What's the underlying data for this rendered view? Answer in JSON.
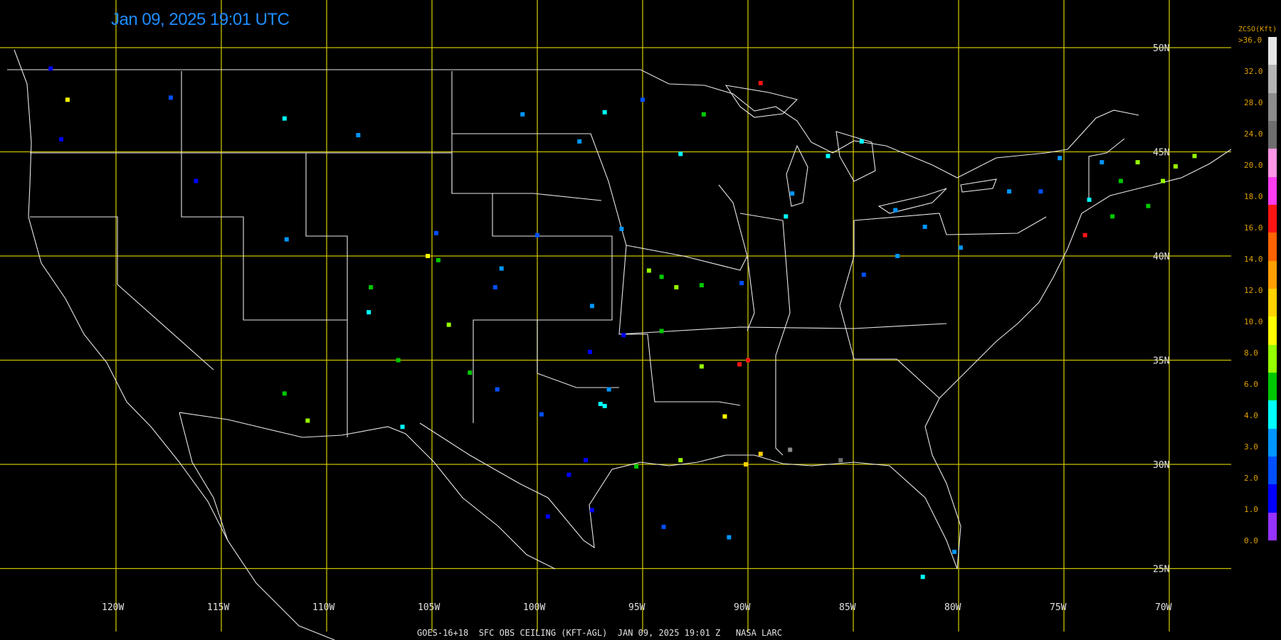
{
  "title": "Jan 09, 2025 19:01 UTC",
  "footer": "GOES-16+18  SFC OBS CEILING (KFT-AGL)  JAN 09, 2025 19:01 Z   NASA LARC",
  "grid": {
    "lon_labels": [
      "120W",
      "115W",
      "110W",
      "105W",
      "100W",
      "95W",
      "90W",
      "85W",
      "80W",
      "75W",
      "70W"
    ],
    "lat_labels": [
      "50N",
      "45N",
      "40N",
      "35N",
      "30N",
      "25N"
    ]
  },
  "legend": {
    "title": "ZCSO(Kft)",
    "labels": [
      ">36.0",
      "32.0",
      "28.0",
      "24.0",
      "20.0",
      "18.0",
      "16.0",
      "14.0",
      "12.0",
      "10.0",
      "8.0",
      "6.0",
      "4.0",
      "3.0",
      "2.0",
      "1.0",
      "0.0"
    ],
    "colors": [
      "#e6e6e6",
      "#b4b4b4",
      "#8c8c8c",
      "#6e6e6e",
      "#ff96e6",
      "#ff3cf0",
      "#ff1414",
      "#ff6400",
      "#ffa000",
      "#ffd200",
      "#ffff00",
      "#96ff00",
      "#00c800",
      "#00ffff",
      "#0096ff",
      "#0050ff",
      "#0000ff",
      "#9632ff"
    ]
  },
  "stations": [
    {
      "lon": -123.1,
      "lat": 49.0,
      "c": 16
    },
    {
      "lon": -122.3,
      "lat": 47.5,
      "c": 10
    },
    {
      "lon": -122.6,
      "lat": 45.6,
      "c": 16
    },
    {
      "lon": -117.4,
      "lat": 47.6,
      "c": 15
    },
    {
      "lon": -116.2,
      "lat": 43.6,
      "c": 16
    },
    {
      "lon": -112.0,
      "lat": 46.6,
      "c": 13
    },
    {
      "lon": -108.5,
      "lat": 45.8,
      "c": 14
    },
    {
      "lon": -111.9,
      "lat": 40.8,
      "c": 14
    },
    {
      "lon": -104.8,
      "lat": 41.1,
      "c": 15
    },
    {
      "lon": -104.7,
      "lat": 39.8,
      "c": 12
    },
    {
      "lon": -105.2,
      "lat": 40.0,
      "c": 10
    },
    {
      "lon": -101.7,
      "lat": 39.4,
      "c": 14
    },
    {
      "lon": -100.7,
      "lat": 46.8,
      "c": 14
    },
    {
      "lon": -96.8,
      "lat": 46.9,
      "c": 13
    },
    {
      "lon": -93.2,
      "lat": 44.9,
      "c": 13
    },
    {
      "lon": -92.1,
      "lat": 46.8,
      "c": 12
    },
    {
      "lon": -96.0,
      "lat": 41.3,
      "c": 14
    },
    {
      "lon": -97.4,
      "lat": 37.6,
      "c": 14
    },
    {
      "lon": -94.7,
      "lat": 39.3,
      "c": 11
    },
    {
      "lon": -93.4,
      "lat": 38.5,
      "c": 11
    },
    {
      "lon": -94.1,
      "lat": 39.0,
      "c": 12
    },
    {
      "lon": -92.2,
      "lat": 38.6,
      "c": 12
    },
    {
      "lon": -90.3,
      "lat": 38.7,
      "c": 15
    },
    {
      "lon": -97.5,
      "lat": 35.4,
      "c": 16
    },
    {
      "lon": -96.8,
      "lat": 32.8,
      "c": 13
    },
    {
      "lon": -97.0,
      "lat": 32.9,
      "c": 13
    },
    {
      "lon": -95.3,
      "lat": 29.9,
      "c": 12
    },
    {
      "lon": -93.2,
      "lat": 30.2,
      "c": 11
    },
    {
      "lon": -90.1,
      "lat": 30.0,
      "c": 9
    },
    {
      "lon": -89.4,
      "lat": 30.5,
      "c": 9
    },
    {
      "lon": -91.1,
      "lat": 32.3,
      "c": 10
    },
    {
      "lon": -92.2,
      "lat": 34.7,
      "c": 11
    },
    {
      "lon": -90.0,
      "lat": 35.0,
      "c": 6
    },
    {
      "lon": -90.4,
      "lat": 34.8,
      "c": 6
    },
    {
      "lon": -98.5,
      "lat": 29.5,
      "c": 16
    },
    {
      "lon": -97.7,
      "lat": 30.2,
      "c": 16
    },
    {
      "lon": -97.4,
      "lat": 27.8,
      "c": 16
    },
    {
      "lon": -99.5,
      "lat": 27.5,
      "c": 16
    },
    {
      "lon": -101.9,
      "lat": 33.6,
      "c": 15
    },
    {
      "lon": -106.6,
      "lat": 35.0,
      "c": 12
    },
    {
      "lon": -106.4,
      "lat": 31.8,
      "c": 13
    },
    {
      "lon": -110.9,
      "lat": 32.1,
      "c": 11
    },
    {
      "lon": -112.0,
      "lat": 33.4,
      "c": 12
    },
    {
      "lon": -88.2,
      "lat": 41.9,
      "c": 13
    },
    {
      "lon": -87.9,
      "lat": 43.0,
      "c": 14
    },
    {
      "lon": -86.2,
      "lat": 44.8,
      "c": 13
    },
    {
      "lon": -84.6,
      "lat": 45.5,
      "c": 13
    },
    {
      "lon": -83.0,
      "lat": 42.2,
      "c": 14
    },
    {
      "lon": -84.5,
      "lat": 39.1,
      "c": 15
    },
    {
      "lon": -82.9,
      "lat": 40.0,
      "c": 14
    },
    {
      "lon": -81.6,
      "lat": 41.4,
      "c": 14
    },
    {
      "lon": -79.9,
      "lat": 40.4,
      "c": 14
    },
    {
      "lon": -77.6,
      "lat": 43.1,
      "c": 14
    },
    {
      "lon": -76.1,
      "lat": 43.1,
      "c": 15
    },
    {
      "lon": -73.8,
      "lat": 42.7,
      "c": 13
    },
    {
      "lon": -72.7,
      "lat": 41.9,
      "c": 12
    },
    {
      "lon": -71.0,
      "lat": 42.4,
      "c": 12
    },
    {
      "lon": -70.3,
      "lat": 43.6,
      "c": 11
    },
    {
      "lon": -69.7,
      "lat": 44.3,
      "c": 11
    },
    {
      "lon": -68.8,
      "lat": 44.8,
      "c": 11
    },
    {
      "lon": -72.3,
      "lat": 43.6,
      "c": 12
    },
    {
      "lon": -71.5,
      "lat": 44.5,
      "c": 11
    },
    {
      "lon": -73.2,
      "lat": 44.5,
      "c": 14
    },
    {
      "lon": -74.0,
      "lat": 41.0,
      "c": 6
    },
    {
      "lon": -75.2,
      "lat": 44.7,
      "c": 14
    },
    {
      "lon": -89.4,
      "lat": 48.3,
      "c": 6
    },
    {
      "lon": -80.2,
      "lat": 25.8,
      "c": 14
    },
    {
      "lon": -81.7,
      "lat": 24.6,
      "c": 13
    },
    {
      "lon": -88.0,
      "lat": 30.7,
      "c": 2
    },
    {
      "lon": -85.6,
      "lat": 30.2,
      "c": 3
    },
    {
      "lon": -94.0,
      "lat": 27.0,
      "c": 15
    },
    {
      "lon": -90.9,
      "lat": 26.5,
      "c": 14
    },
    {
      "lon": -102.0,
      "lat": 38.5,
      "c": 15
    },
    {
      "lon": -100.0,
      "lat": 41.0,
      "c": 15
    },
    {
      "lon": -98.0,
      "lat": 45.5,
      "c": 14
    },
    {
      "lon": -95.0,
      "lat": 47.5,
      "c": 15
    },
    {
      "lon": -108.0,
      "lat": 37.3,
      "c": 13
    },
    {
      "lon": -107.9,
      "lat": 38.5,
      "c": 12
    },
    {
      "lon": -104.2,
      "lat": 36.7,
      "c": 11
    },
    {
      "lon": -103.2,
      "lat": 34.4,
      "c": 12
    },
    {
      "lon": -96.6,
      "lat": 33.6,
      "c": 14
    },
    {
      "lon": -95.9,
      "lat": 36.2,
      "c": 16
    },
    {
      "lon": -94.1,
      "lat": 36.4,
      "c": 12
    },
    {
      "lon": -99.8,
      "lat": 32.4,
      "c": 15
    }
  ]
}
